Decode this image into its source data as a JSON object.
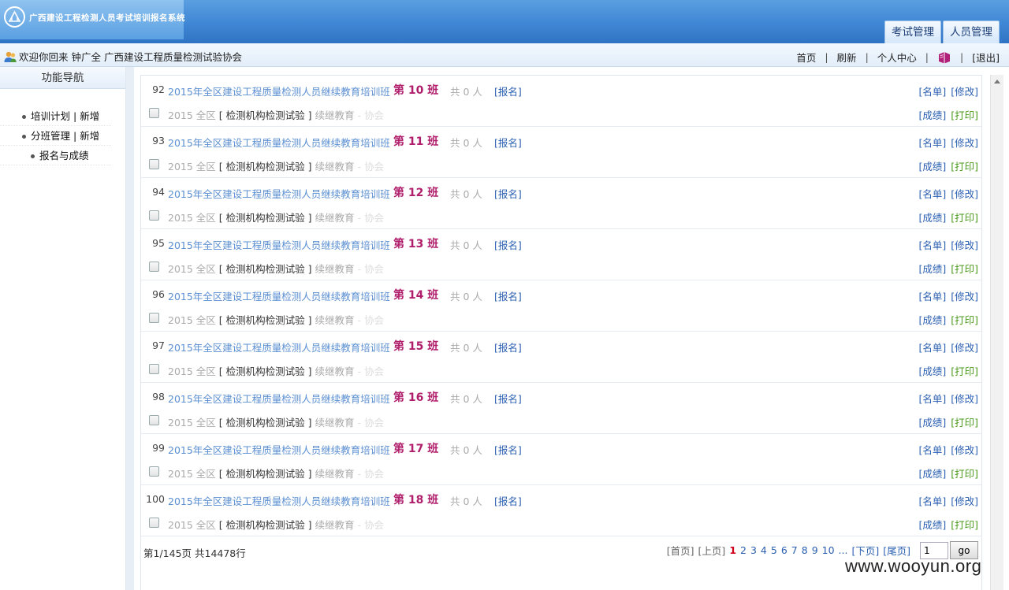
{
  "app": {
    "title": "广西建设工程检测人员考试培训报名系统",
    "tabs": [
      "考试管理",
      "人员管理"
    ]
  },
  "infobar": {
    "welcome": "欢迎你回来 钟广全 广西建设工程质量检测试验协会",
    "links": {
      "home": "首页",
      "refresh": "刷新",
      "profile": "个人中心",
      "logout": "[退出]"
    },
    "sep": "|"
  },
  "sidebar": {
    "title": "功能导航",
    "items": [
      {
        "a": "培训计划",
        "sep": " | ",
        "b": "新增"
      },
      {
        "a": "分班管理",
        "sep": " | ",
        "b": "新增"
      },
      {
        "a": "报名与成绩"
      }
    ]
  },
  "rows": [
    {
      "num": "92",
      "title": "2015年全区建设工程质量检测人员继续教育培训班",
      "cls_prefix": "第",
      "cls_num": "10",
      "cls_suffix": "班",
      "count": "共 0 人",
      "signup": "[报名]",
      "year": "2015 全区",
      "org_l": "[",
      "org": "检测机构检测试验",
      "org_r": "]",
      "edu": "续继教育",
      "assoc": "- 协会",
      "list": "[名单]",
      "edit": "[修改]",
      "score": "[成绩]",
      "print": "[打印]"
    },
    {
      "num": "93",
      "title": "2015年全区建设工程质量检测人员继续教育培训班",
      "cls_prefix": "第",
      "cls_num": "11",
      "cls_suffix": "班",
      "count": "共 0 人",
      "signup": "[报名]",
      "year": "2015 全区",
      "org_l": "[",
      "org": "检测机构检测试验",
      "org_r": "]",
      "edu": "续继教育",
      "assoc": "- 协会",
      "list": "[名单]",
      "edit": "[修改]",
      "score": "[成绩]",
      "print": "[打印]"
    },
    {
      "num": "94",
      "title": "2015年全区建设工程质量检测人员继续教育培训班",
      "cls_prefix": "第",
      "cls_num": "12",
      "cls_suffix": "班",
      "count": "共 0 人",
      "signup": "[报名]",
      "year": "2015 全区",
      "org_l": "[",
      "org": "检测机构检测试验",
      "org_r": "]",
      "edu": "续继教育",
      "assoc": "- 协会",
      "list": "[名单]",
      "edit": "[修改]",
      "score": "[成绩]",
      "print": "[打印]"
    },
    {
      "num": "95",
      "title": "2015年全区建设工程质量检测人员继续教育培训班",
      "cls_prefix": "第",
      "cls_num": "13",
      "cls_suffix": "班",
      "count": "共 0 人",
      "signup": "[报名]",
      "year": "2015 全区",
      "org_l": "[",
      "org": "检测机构检测试验",
      "org_r": "]",
      "edu": "续继教育",
      "assoc": "- 协会",
      "list": "[名单]",
      "edit": "[修改]",
      "score": "[成绩]",
      "print": "[打印]"
    },
    {
      "num": "96",
      "title": "2015年全区建设工程质量检测人员继续教育培训班",
      "cls_prefix": "第",
      "cls_num": "14",
      "cls_suffix": "班",
      "count": "共 0 人",
      "signup": "[报名]",
      "year": "2015 全区",
      "org_l": "[",
      "org": "检测机构检测试验",
      "org_r": "]",
      "edu": "续继教育",
      "assoc": "- 协会",
      "list": "[名单]",
      "edit": "[修改]",
      "score": "[成绩]",
      "print": "[打印]"
    },
    {
      "num": "97",
      "title": "2015年全区建设工程质量检测人员继续教育培训班",
      "cls_prefix": "第",
      "cls_num": "15",
      "cls_suffix": "班",
      "count": "共 0 人",
      "signup": "[报名]",
      "year": "2015 全区",
      "org_l": "[",
      "org": "检测机构检测试验",
      "org_r": "]",
      "edu": "续继教育",
      "assoc": "- 协会",
      "list": "[名单]",
      "edit": "[修改]",
      "score": "[成绩]",
      "print": "[打印]"
    },
    {
      "num": "98",
      "title": "2015年全区建设工程质量检测人员继续教育培训班",
      "cls_prefix": "第",
      "cls_num": "16",
      "cls_suffix": "班",
      "count": "共 0 人",
      "signup": "[报名]",
      "year": "2015 全区",
      "org_l": "[",
      "org": "检测机构检测试验",
      "org_r": "]",
      "edu": "续继教育",
      "assoc": "- 协会",
      "list": "[名单]",
      "edit": "[修改]",
      "score": "[成绩]",
      "print": "[打印]"
    },
    {
      "num": "99",
      "title": "2015年全区建设工程质量检测人员继续教育培训班",
      "cls_prefix": "第",
      "cls_num": "17",
      "cls_suffix": "班",
      "count": "共 0 人",
      "signup": "[报名]",
      "year": "2015 全区",
      "org_l": "[",
      "org": "检测机构检测试验",
      "org_r": "]",
      "edu": "续继教育",
      "assoc": "- 协会",
      "list": "[名单]",
      "edit": "[修改]",
      "score": "[成绩]",
      "print": "[打印]"
    },
    {
      "num": "100",
      "title": "2015年全区建设工程质量检测人员继续教育培训班",
      "cls_prefix": "第",
      "cls_num": "18",
      "cls_suffix": "班",
      "count": "共 0 人",
      "signup": "[报名]",
      "year": "2015 全区",
      "org_l": "[",
      "org": "检测机构检测试验",
      "org_r": "]",
      "edu": "续继教育",
      "assoc": "- 协会",
      "list": "[名单]",
      "edit": "[修改]",
      "score": "[成绩]",
      "print": "[打印]"
    }
  ],
  "pager": {
    "summary": "第1/145页 共14478行",
    "first": "[首页]",
    "prev": "[上页]",
    "pages": [
      "1",
      "2",
      "3",
      "4",
      "5",
      "6",
      "7",
      "8",
      "9",
      "10"
    ],
    "current": "1",
    "ellipsis": "...",
    "next": "[下页]",
    "last": "[尾页]",
    "input_value": "1",
    "go": "go"
  },
  "watermark": "www.wooyun.org",
  "colors": {
    "header_blue": "#3f86d4",
    "link_blue": "#2a5fb1",
    "class_magenta": "#b01d6b",
    "print_green": "#4a9a1a",
    "current_page_red": "#d0001c"
  }
}
